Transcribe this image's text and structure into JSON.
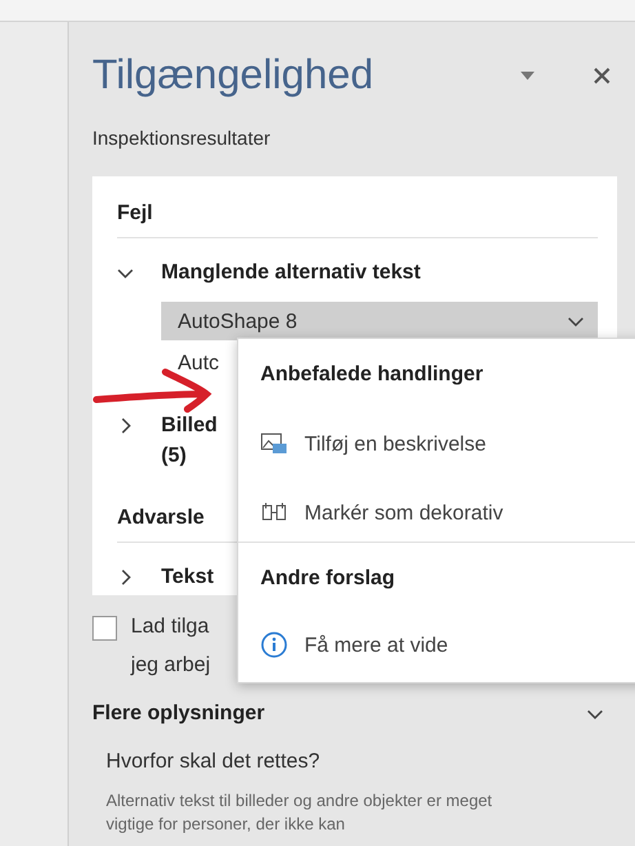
{
  "pane": {
    "title": "Tilgængelighed",
    "subtitle": "Inspektionsresultater"
  },
  "errors": {
    "heading": "Fejl",
    "groups": [
      {
        "label": "Manglende alternativ tekst",
        "expanded": true,
        "children": [
          {
            "label": "AutoShape 8",
            "selected": true
          },
          {
            "label": "Autc",
            "selected": false
          }
        ]
      },
      {
        "label": "Billed",
        "count": "(5)",
        "expanded": false
      }
    ]
  },
  "warnings": {
    "heading": "Advarsle",
    "groups": [
      {
        "label": "Tekst",
        "expanded": false
      }
    ]
  },
  "checkbox": {
    "lines": [
      "Lad tilga",
      "jeg arbej"
    ],
    "checked": false
  },
  "menu": {
    "sections": [
      {
        "heading": "Anbefalede handlinger",
        "items": [
          {
            "label": "Tilføj en beskrivelse",
            "kind": "image"
          },
          {
            "label": "Markér som dekorativ",
            "kind": "decorative"
          }
        ]
      },
      {
        "heading": "Andre forslag",
        "items": [
          {
            "label": "Få mere at vide",
            "kind": "info"
          }
        ]
      }
    ]
  },
  "details": {
    "heading": "Flere oplysninger",
    "expanded": true,
    "question": "Hvorfor skal det rettes?",
    "body": "Alternativ tekst til billeder og andre objekter er meget vigtige for personer, der ikke kan"
  }
}
